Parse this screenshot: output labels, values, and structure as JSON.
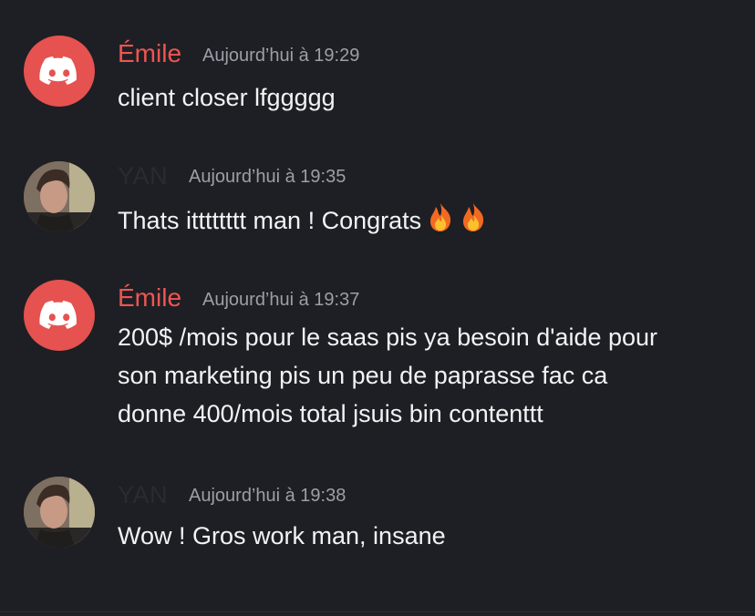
{
  "messages": [
    {
      "author": "Émile",
      "timestamp": "Aujourd’hui à 19:29",
      "lines": [
        "client closer lfggggg"
      ],
      "avatar": "discord-logo-icon"
    },
    {
      "author": "YAN",
      "timestamp": "Aujourd’hui à 19:35",
      "lines": [
        "Thats itttttttt man ! Congrats"
      ],
      "avatar": "user-photo",
      "emojis": [
        "fire-emoji",
        "fire-emoji"
      ]
    },
    {
      "author": "Émile",
      "timestamp": "Aujourd’hui à 19:37",
      "lines": [
        "200$ /mois pour le saas pis ya besoin d'aide pour",
        "son marketing pis un peu de paprasse fac ca",
        "donne 400/mois total jsuis bin contenttt"
      ],
      "avatar": "discord-logo-icon"
    },
    {
      "author": "YAN",
      "timestamp": "Aujourd’hui à 19:38",
      "lines": [
        "Wow ! Gros work man, insane"
      ],
      "avatar": "user-photo"
    }
  ],
  "colors": {
    "background": "#1e1f24",
    "discord_avatar": "#e5524f",
    "emile_name": "#ef5552",
    "timestamp": "#9c9fa7",
    "message_text": "#f2f3f5"
  }
}
